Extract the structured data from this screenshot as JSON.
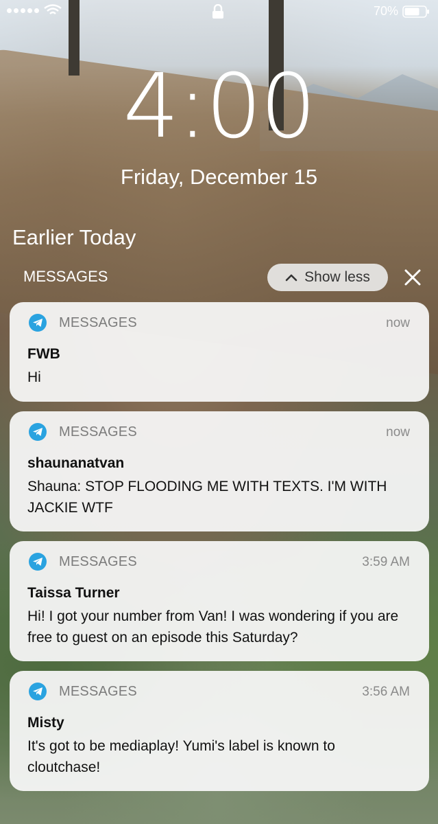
{
  "status_bar": {
    "battery_text": "70%"
  },
  "lock_screen": {
    "time": "4:00",
    "date": "Friday, December 15",
    "section_title": "Earlier Today",
    "group_label": "MESSAGES",
    "show_less_label": "Show less"
  },
  "notifications": [
    {
      "app": "MESSAGES",
      "time": "now",
      "sender": "FWB",
      "body": "Hi"
    },
    {
      "app": "MESSAGES",
      "time": "now",
      "sender": "shaunanatvan",
      "body": "Shauna: STOP FLOODING ME WITH TEXTS. I'M WITH JACKIE WTF"
    },
    {
      "app": "MESSAGES",
      "time": "3:59 AM",
      "sender": "Taissa Turner",
      "body": "Hi! I got your number from Van! I was wondering if you are free to guest on an episode this Saturday?"
    },
    {
      "app": "MESSAGES",
      "time": "3:56 AM",
      "sender": "Misty",
      "body": "It's got to be mediaplay! Yumi's label is known to cloutchase!"
    }
  ],
  "icons": {
    "status": [
      "signal-icon",
      "wifi-icon",
      "lock-icon",
      "battery-icon"
    ],
    "app_icon": "telegram-plane-icon",
    "controls": [
      "chevron-up-icon",
      "close-icon"
    ]
  },
  "colors": {
    "app_icon_blue": "#2aa3e0",
    "card_bg": "#f6f6f6"
  }
}
